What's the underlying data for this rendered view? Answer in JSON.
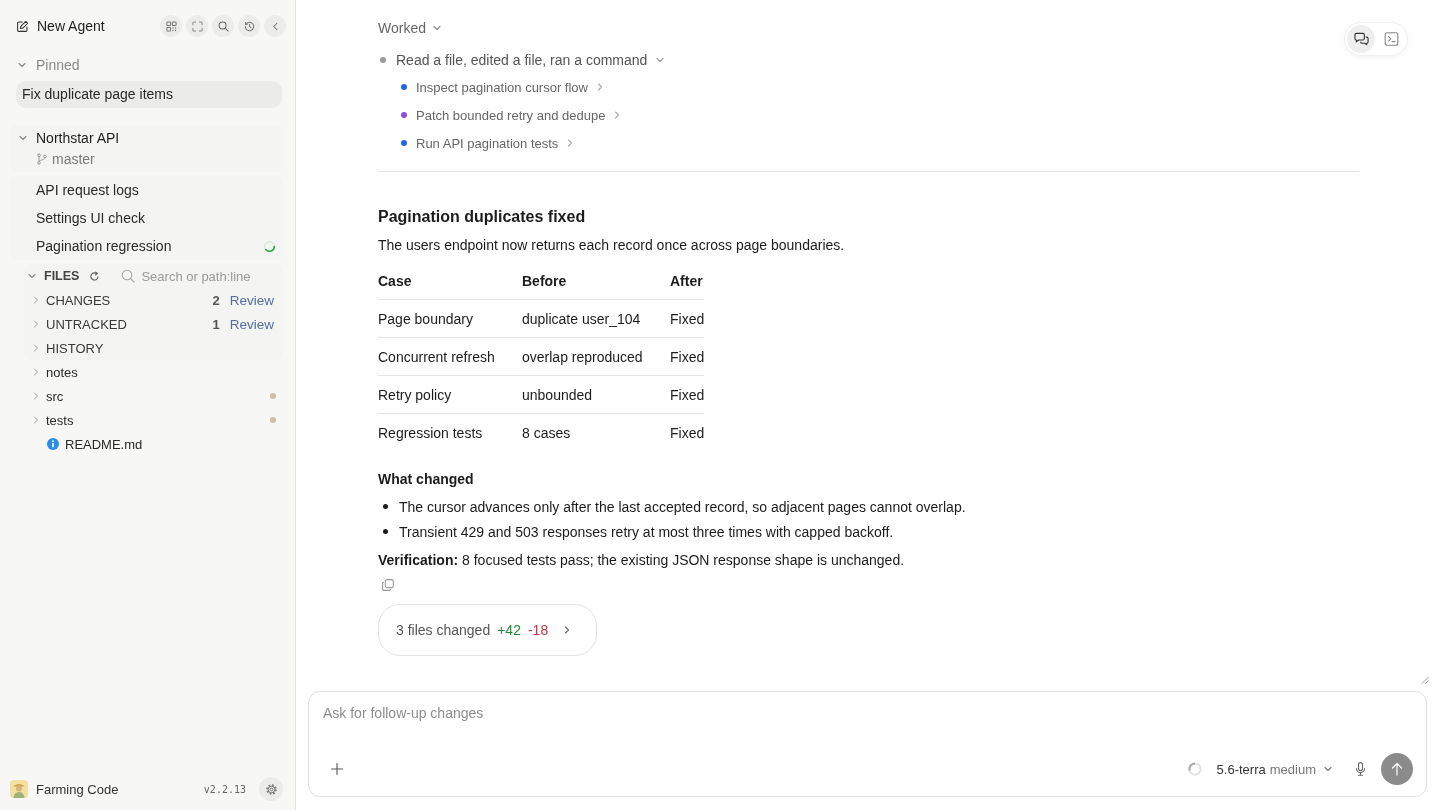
{
  "sidebar": {
    "title": "New Agent",
    "pinned": {
      "label": "Pinned",
      "expanded": true,
      "items": [
        {
          "label": "Fix duplicate page items",
          "selected": true
        }
      ]
    },
    "project": {
      "name": "Northstar API",
      "expanded": true,
      "branch": "master",
      "threads": [
        {
          "label": "API request logs",
          "running": false
        },
        {
          "label": "Settings UI check",
          "running": false
        },
        {
          "label": "Pagination regression",
          "running": true
        }
      ]
    },
    "files": {
      "label": "FILES",
      "expanded": true,
      "search": {
        "placeholder": "Search or path:line"
      },
      "sections": [
        {
          "label": "CHANGES",
          "expanded": false,
          "count": "2",
          "action": "Review"
        },
        {
          "label": "UNTRACKED",
          "expanded": false,
          "count": "1",
          "action": "Review"
        },
        {
          "label": "HISTORY",
          "expanded": false
        }
      ],
      "tree": [
        {
          "name": "notes",
          "kind": "folder",
          "expanded": false,
          "modified": false
        },
        {
          "name": "src",
          "kind": "folder",
          "expanded": false,
          "modified": true
        },
        {
          "name": "tests",
          "kind": "folder",
          "expanded": false,
          "modified": true
        },
        {
          "name": "README.md",
          "kind": "file",
          "modified": false
        }
      ]
    },
    "footer": {
      "user": "Farming Code",
      "version": "v2.2.13"
    }
  },
  "main": {
    "view_toggle": [
      {
        "kind": "chat",
        "selected": true
      },
      {
        "kind": "terminal",
        "selected": false
      }
    ],
    "activity": {
      "label": "Worked",
      "expanded": true,
      "summary": {
        "label": "Read a file, edited a file, ran a command",
        "expanded": true
      },
      "steps": [
        {
          "label": "Inspect pagination cursor flow",
          "color": "#1f66e5"
        },
        {
          "label": "Patch bounded retry and dedupe",
          "color": "#8b4fe6"
        },
        {
          "label": "Run API pagination tests",
          "color": "#1f66e5"
        }
      ]
    },
    "result": {
      "title": "Pagination duplicates fixed",
      "intro": "The users endpoint now returns each record once across page boundaries.",
      "table": {
        "columns": [
          "Case",
          "Before",
          "After"
        ],
        "rows": [
          [
            "Page boundary",
            "duplicate user_104",
            "Fixed"
          ],
          [
            "Concurrent refresh",
            "overlap reproduced",
            "Fixed"
          ],
          [
            "Retry policy",
            "unbounded",
            "Fixed"
          ],
          [
            "Regression tests",
            "8 cases",
            "Fixed"
          ]
        ]
      },
      "subheading": "What changed",
      "bullets": [
        "The cursor advances only after the last accepted record, so adjacent pages cannot overlap.",
        "Transient 429 and 503 responses retry at most three times with capped backoff."
      ],
      "verification": "**Verification:** 8 focused tests pass; the existing JSON response shape is unchanged."
    },
    "diff_summary": {
      "label": "3 files changed",
      "added": "+42",
      "removed": "-18"
    }
  },
  "composer": {
    "placeholder": "Ask for follow-up changes",
    "model": "5.6-terra",
    "effort": "medium"
  }
}
